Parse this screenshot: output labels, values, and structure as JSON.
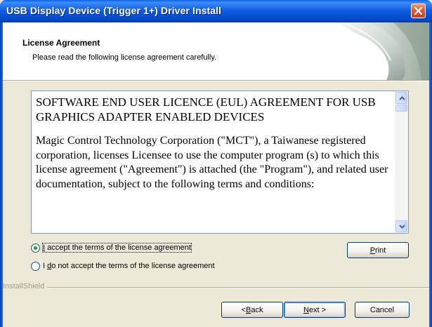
{
  "window": {
    "title": "USB Display Device (Trigger 1+) Driver Install"
  },
  "header": {
    "title": "License Agreement",
    "subtitle": "Please read the following license agreement carefully."
  },
  "license": {
    "heading": "SOFTWARE END USER LICENCE (EUL) AGREEMENT FOR USB GRAPHICS ADAPTER ENABLED DEVICES",
    "body": "Magic Control Technology Corporation (\"MCT\"), a Taiwanese registered corporation, licenses Licensee to use the computer program (s) to which this license agreement (\"Agreement\") is attached (the \"Program\"), and related user documentation, subject to the following terms and conditions:"
  },
  "options": {
    "accept_pre": "",
    "accept_mnemonic": "I",
    "accept_post": " accept the terms of the license agreement",
    "decline_pre": "I ",
    "decline_mnemonic": "d",
    "decline_post": "o not accept the terms of the license agreement",
    "selected": "accept"
  },
  "buttons": {
    "print_pre": "",
    "print_mnemonic": "P",
    "print_post": "rint",
    "back_pre": "< ",
    "back_mnemonic": "B",
    "back_post": "ack",
    "next_pre": "",
    "next_mnemonic": "N",
    "next_post": "ext >",
    "cancel": "Cancel"
  },
  "footer": {
    "brand": "InstallShield"
  },
  "icons": {
    "close": "close-x-icon",
    "scroll_up": "scroll-up-arrow-icon",
    "scroll_down": "scroll-down-arrow-icon",
    "header_graphic": "installshield-wave-graphic"
  }
}
